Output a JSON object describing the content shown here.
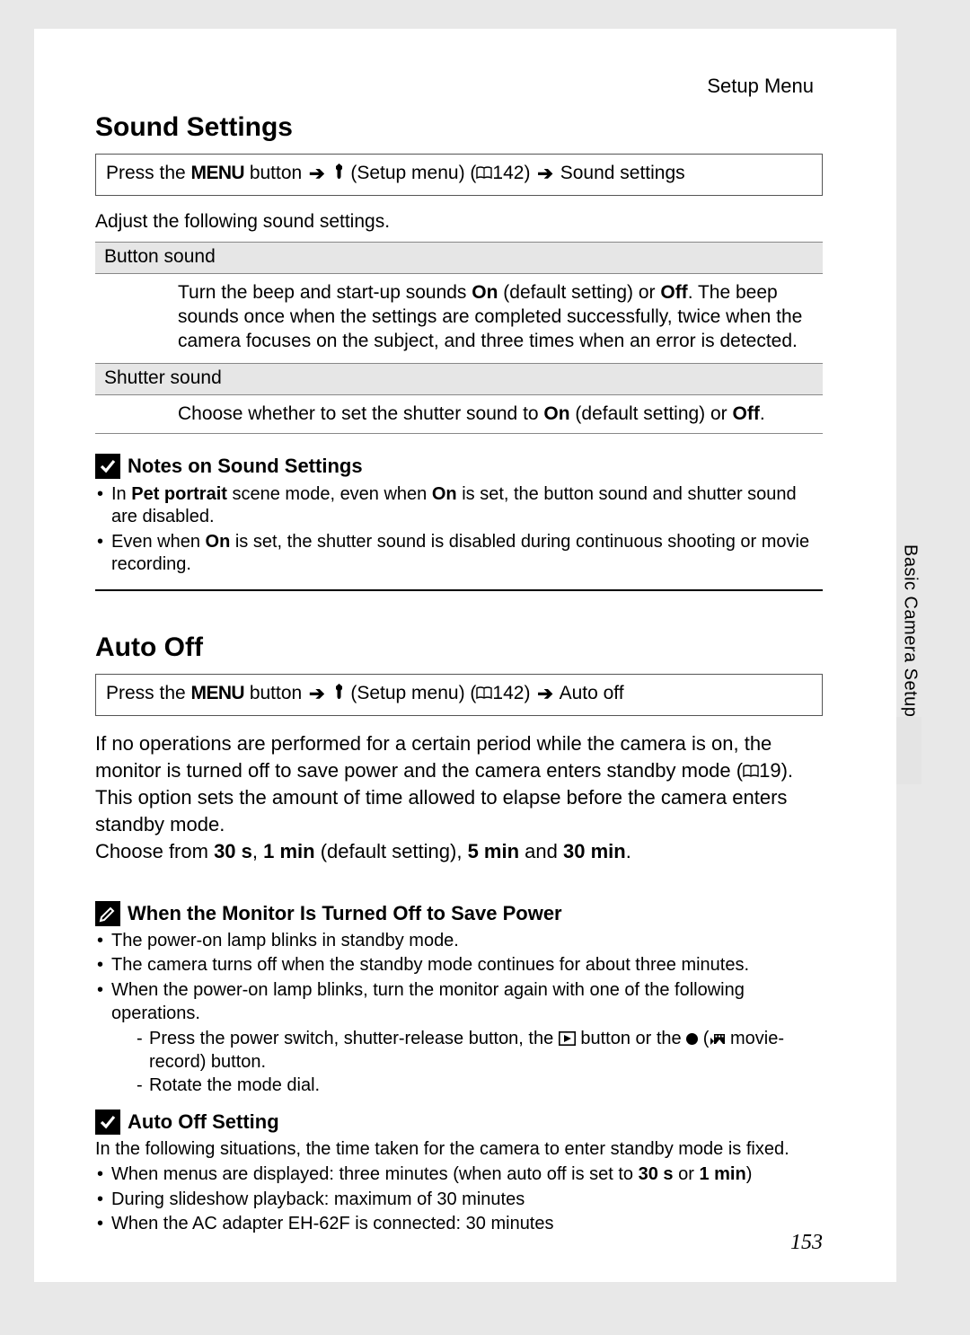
{
  "header_label": "Setup Menu",
  "side_tab": "Basic Camera Setup",
  "page_number": "153",
  "nav_path_parts": {
    "press_the": "Press the ",
    "menu_word": "MENU",
    "button": " button ",
    "setup_menu_fragment": " (Setup menu) (",
    "ref142": "142) ",
    "end_sound": " Sound settings",
    "end_autooff": " Auto off",
    "ref19": "19)."
  },
  "sound": {
    "heading": "Sound Settings",
    "intro": "Adjust the following sound settings.",
    "options": [
      {
        "name": "Button sound",
        "desc_pre": "Turn the beep and start-up sounds ",
        "on": "On",
        "mid1": " (default setting) or ",
        "off": "Off",
        "desc_post": ". The beep sounds once when the settings are completed successfully, twice when the camera focuses on the subject, and three times when an error is detected."
      },
      {
        "name": "Shutter sound",
        "desc_pre": "Choose whether to set the shutter sound to ",
        "on": "On",
        "mid1": " (default setting) or ",
        "off": "Off",
        "desc_post": "."
      }
    ],
    "notes_title": "Notes on Sound Settings",
    "notes": {
      "n1_pre": "In ",
      "n1_bold": "Pet portrait",
      "n1_mid": " scene mode, even when ",
      "n1_on": "On",
      "n1_post": " is set, the button sound and shutter sound are disabled.",
      "n2_pre": "Even when ",
      "n2_on": "On",
      "n2_post": " is set, the shutter sound is disabled during continuous shooting or movie recording."
    }
  },
  "autooff": {
    "heading": "Auto Off",
    "body_part1": "If no operations are performed for a certain period while the camera is on, the monitor is turned off to save power and the camera enters standby mode (",
    "body_part2": "This option sets the amount of time allowed to elapse before the camera enters standby mode.",
    "choose_pre": "Choose from ",
    "opt30s": "30 s",
    "sep1": ", ",
    "opt1min": "1 min",
    "default_txt": " (default setting), ",
    "opt5min": "5 min",
    "and_txt": " and ",
    "opt30min": "30 min",
    "period": ".",
    "monitor_note_title": "When the Monitor Is Turned Off to Save Power",
    "monitor_bullets": {
      "b1": "The power-on lamp blinks in standby mode.",
      "b2": "The camera turns off when the standby mode continues for about three minutes.",
      "b3": "When the power-on lamp blinks, turn the monitor again with one of the following operations.",
      "sub1_pre": "Press the power switch, shutter-release button, the ",
      "sub1_mid": " button or the ",
      "sub1_paren_open": " (",
      "sub1_movie_record": " movie-record) button.",
      "sub2": "Rotate the mode dial."
    },
    "setting_note_title": "Auto Off Setting",
    "setting_intro": "In the following situations, the time taken for the camera to enter standby mode is fixed.",
    "setting_bullets": {
      "s1_pre": "When menus are displayed: three minutes (when auto off is set to ",
      "s1_30s": "30 s",
      "s1_or": " or ",
      "s1_1min": "1 min",
      "s1_end": ")",
      "s2": "During slideshow playback: maximum of 30 minutes",
      "s3": "When the AC adapter EH-62F is connected: 30 minutes"
    }
  }
}
